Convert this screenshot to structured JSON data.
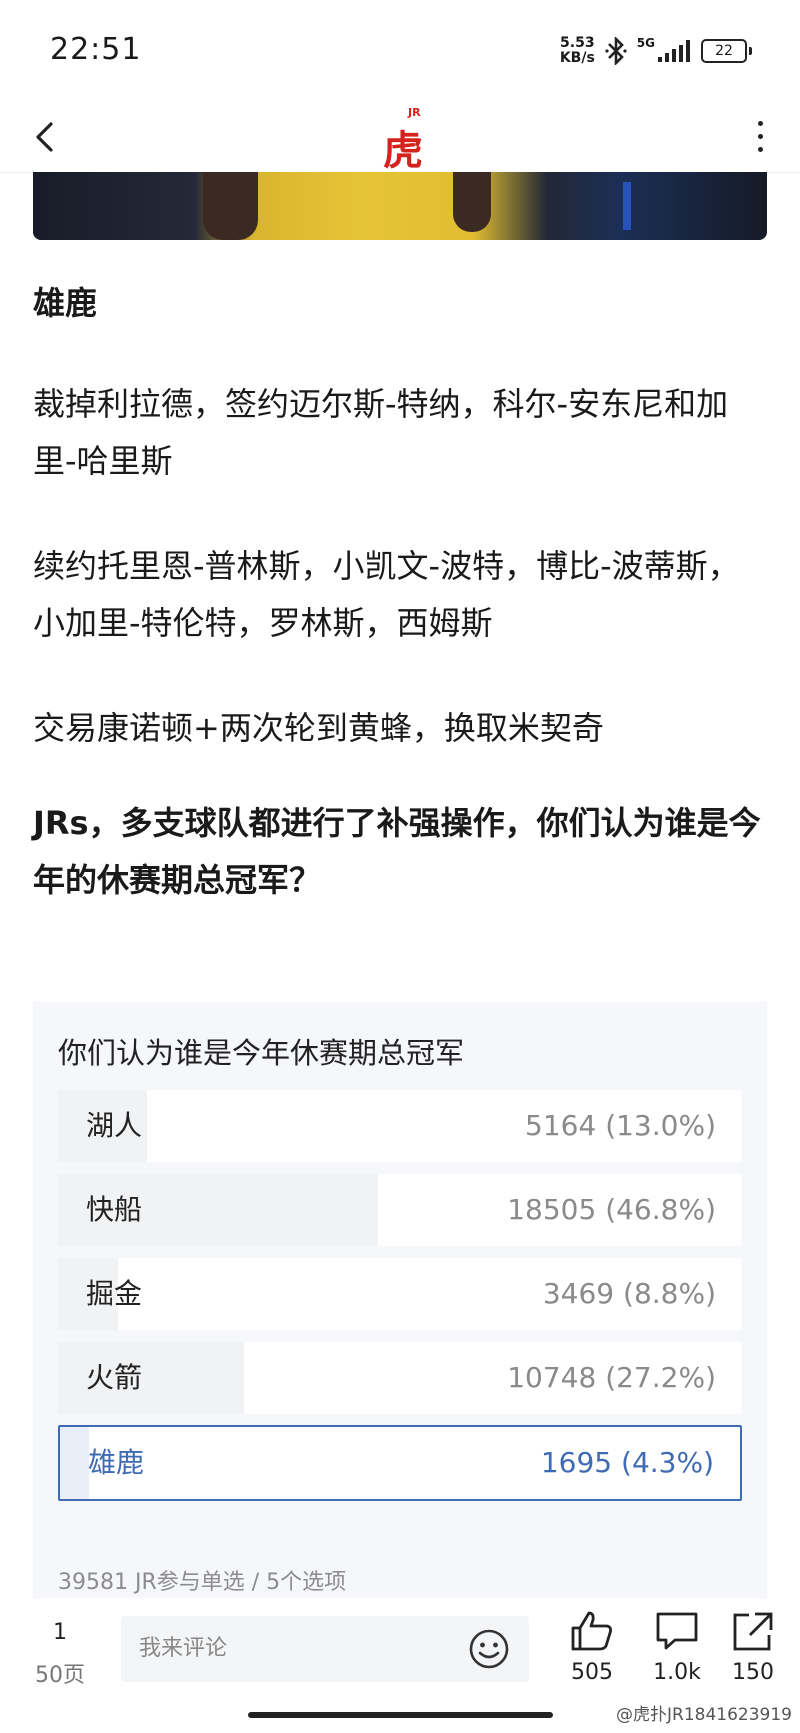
{
  "status_bar": {
    "time": "22:51",
    "net_speed_value": "5.53",
    "net_speed_unit": "KB/s",
    "network": "5G",
    "battery": "22"
  },
  "header": {
    "logo_text": "虎扑",
    "logo_badge": "JR"
  },
  "article": {
    "team": "雄鹿",
    "para1": "裁掉利拉德，签约迈尔斯-特纳，科尔-安东尼和加里-哈里斯",
    "para2": "续约托里恩-普林斯，小凯文-波特，博比-波蒂斯，小加里-特伦特，罗林斯，西姆斯",
    "para3": "交易康诺顿+两次轮到黄蜂，换取米契奇",
    "question": "JRs，多支球队都进行了补强操作，你们认为谁是今年的休赛期总冠军？"
  },
  "poll": {
    "title": "你们认为谁是今年休赛期总冠军",
    "options": [
      {
        "label": "湖人",
        "count": "5164 (13.0%)",
        "share": 0.13
      },
      {
        "label": "快船",
        "count": "18505 (46.8%)",
        "share": 0.468
      },
      {
        "label": "掘金",
        "count": "3469 (8.8%)",
        "share": 0.088
      },
      {
        "label": "火箭",
        "count": "10748 (27.2%)",
        "share": 0.272
      },
      {
        "label": "雄鹿",
        "count": "1695 (4.3%)",
        "share": 0.043,
        "selected": true
      }
    ],
    "footer": "39581 JR参与单选 / 5个选项"
  },
  "bottom_bar": {
    "current_page": "1",
    "total_pages": "50页",
    "comment_placeholder": "我来评论",
    "likes": "505",
    "comments": "1.0k",
    "shares": "150"
  },
  "watermark": "@虎扑JR1841623919",
  "colors": {
    "brand_red": "#d4231f",
    "selected_blue": "#3e6bb3",
    "poll_bg": "#f5f7fa"
  }
}
